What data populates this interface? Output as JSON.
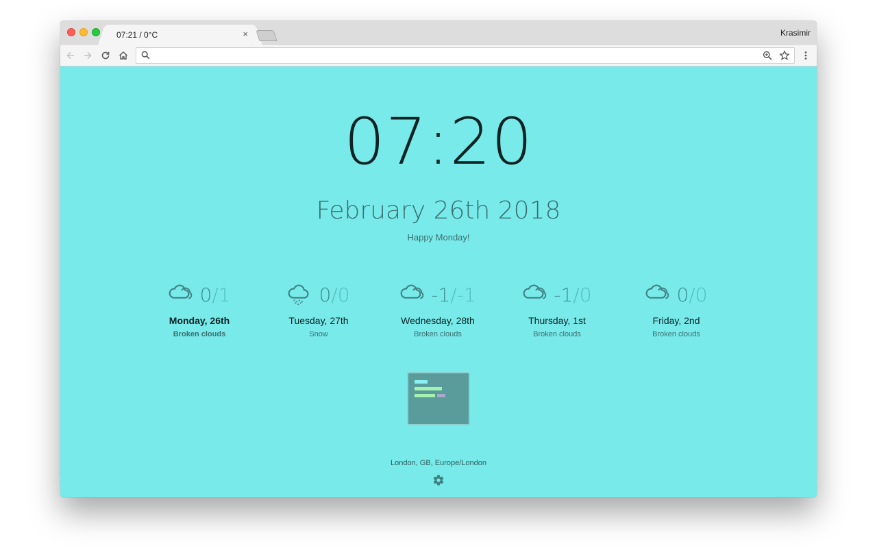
{
  "browser": {
    "tab_title": "07:21 / 0°C",
    "tab_close": "×",
    "profile_name": "Krasimir",
    "address_value": "",
    "address_placeholder": ""
  },
  "clock": {
    "time": "07:20"
  },
  "date": {
    "text": "February 26th 2018",
    "greeting": "Happy Monday!"
  },
  "forecast": [
    {
      "min": "0",
      "max": "1",
      "day": "Monday, 26th",
      "desc": "Broken clouds",
      "icon": "cloud-icon",
      "today": true
    },
    {
      "min": "0",
      "max": "0",
      "day": "Tuesday, 27th",
      "desc": "Snow",
      "icon": "snow-cloud-icon",
      "today": false
    },
    {
      "min": "-1",
      "max": "-1",
      "day": "Wednesday, 28th",
      "desc": "Broken clouds",
      "icon": "cloud-icon",
      "today": false
    },
    {
      "min": "-1",
      "max": "0",
      "day": "Thursday, 1st",
      "desc": "Broken clouds",
      "icon": "cloud-icon",
      "today": false
    },
    {
      "min": "0",
      "max": "0",
      "day": "Friday, 2nd",
      "desc": "Broken clouds",
      "icon": "cloud-icon",
      "today": false
    }
  ],
  "temp_separator": "/",
  "footer": {
    "location": "London, GB, Europe/London",
    "settings_icon": "gear-icon"
  },
  "colors": {
    "background": "#78eaea",
    "text_dark": "#0e2323",
    "muted": "#3d6e6e",
    "accent": "#54bdbd",
    "widget": "#5a9c9c"
  }
}
